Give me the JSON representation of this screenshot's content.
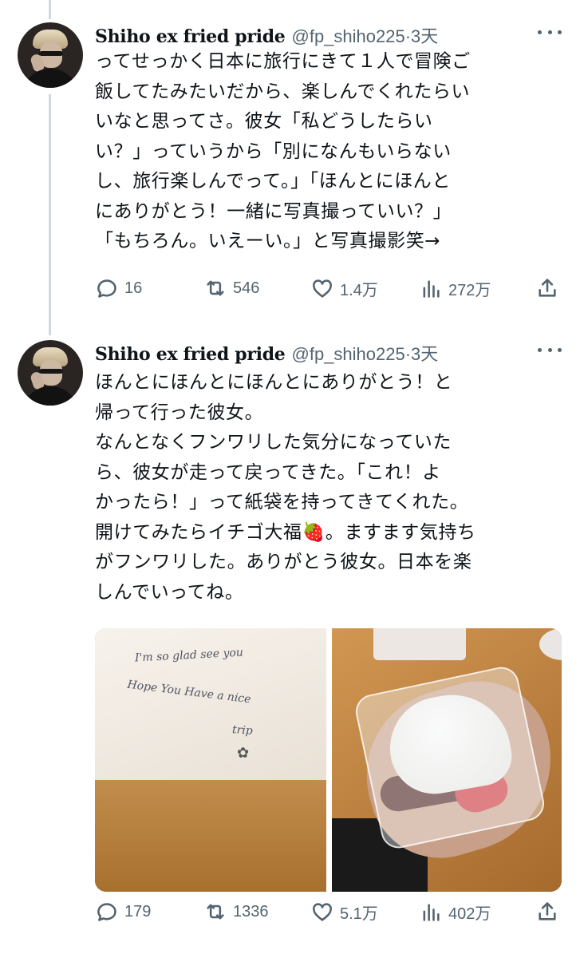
{
  "tweets": [
    {
      "author_name": "Shiho ex fried pride",
      "meta": "@fp_shiho225·3天",
      "text": "ってせっかく日本に旅行にきて１人で冒険ご\n飯してたみたいだから、楽しんでくれたらい\nいなと思ってさ。彼女「私どうしたらい\nい？」っていうから「別になんもいらない\nし、旅行楽しんでって。」「ほんとにほんと\nにありがとう！一緒に写真撮っていい？」\n「もちろん。いえーい。」と写真撮影笑→",
      "stats": {
        "replies": "16",
        "reposts": "546",
        "likes": "1.4万",
        "views": "272万"
      }
    },
    {
      "author_name": "Shiho ex fried pride",
      "meta": "@fp_shiho225·3天",
      "text": "ほんとにほんとにほんとにありがとう！と\n帰って行った彼女。\nなんとなくフンワリした気分になっていた\nら、彼女が走って戻ってきた。「これ！よ\nかったら！」って紙袋を持ってきてくれた。\n開けてみたらイチゴ大福🍓。ますます気持ち\nがフンワリした。ありがとう彼女。日本を楽\nしんでいってね。",
      "stats": {
        "replies": "179",
        "reposts": "1336",
        "likes": "5.1万",
        "views": "402万"
      },
      "media_note": {
        "line1": "I'm so glad see you",
        "line2": "Hope You Have a nice",
        "line3": "trip"
      }
    }
  ],
  "icons": {
    "reply": "reply-icon",
    "repost": "repost-icon",
    "like": "heart-icon",
    "views": "analytics-icon",
    "share": "share-icon",
    "more": "more-icon"
  },
  "colors": {
    "text": "#0f1419",
    "secondary": "#536471",
    "thread_line": "#cfd9de"
  }
}
